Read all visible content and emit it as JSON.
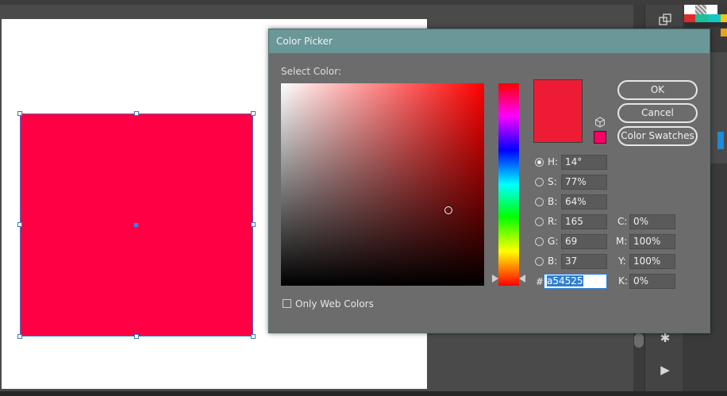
{
  "dialog": {
    "title": "Color Picker",
    "select_color_label": "Select Color:",
    "only_web_colors_label": "Only Web Colors",
    "buttons": {
      "ok": "OK",
      "cancel": "Cancel",
      "swatches": "Color Swatches"
    },
    "hsb": [
      {
        "label": "H:",
        "value": "14°",
        "selected": true
      },
      {
        "label": "S:",
        "value": "77%",
        "selected": false
      },
      {
        "label": "B:",
        "value": "64%",
        "selected": false
      }
    ],
    "rgb": [
      {
        "label": "R:",
        "value": "165"
      },
      {
        "label": "G:",
        "value": "69"
      },
      {
        "label": "B:",
        "value": "37"
      }
    ],
    "cmyk": [
      {
        "label": "C:",
        "value": "0%"
      },
      {
        "label": "M:",
        "value": "100%"
      },
      {
        "label": "Y:",
        "value": "100%"
      },
      {
        "label": "K:",
        "value": "0%"
      }
    ],
    "hex": {
      "symbol": "#",
      "value": "a54525"
    },
    "new_color": "#ed1c34",
    "web_safe_color": "#ff0066"
  },
  "canvas": {
    "shape_fill": "#ff0044",
    "selection_color": "#3a78c8"
  },
  "icons": {
    "tool_top": "transform-icon",
    "tool_gear": "settings-icon",
    "tool_play": "play-icon",
    "gamut_warning": "cube-icon"
  },
  "colors": {
    "titlebar": "#6a9797",
    "dialog_bg": "#6c6c6c",
    "hex_highlight": "#2f7fd1"
  }
}
